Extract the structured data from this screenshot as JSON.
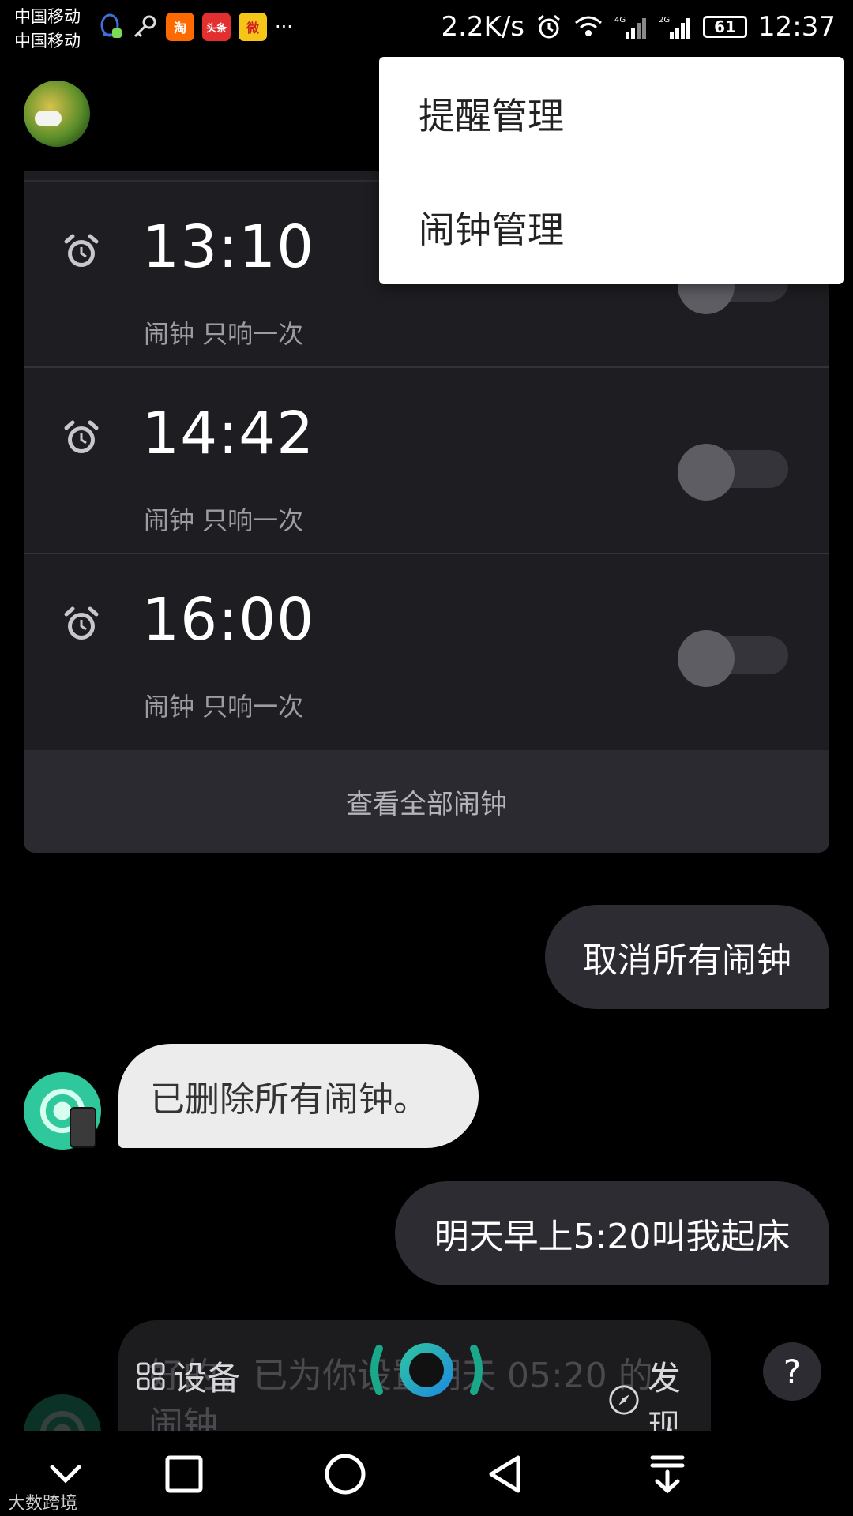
{
  "status_bar": {
    "carrier_1": "中国移动",
    "carrier_2": "中国移动",
    "apps": [
      "淘",
      "头条",
      "微"
    ],
    "more": "···",
    "net_speed": "2.2K/s",
    "net_4g": "4G",
    "net_2g": "2G",
    "battery": "61",
    "time": "12:37"
  },
  "menu": {
    "items": [
      {
        "label": "提醒管理"
      },
      {
        "label": "闹钟管理"
      }
    ]
  },
  "alarms": {
    "items": [
      {
        "time": "13:10",
        "desc": "闹钟 只响一次",
        "enabled": false
      },
      {
        "time": "14:42",
        "desc": "闹钟 只响一次",
        "enabled": false
      },
      {
        "time": "16:00",
        "desc": "闹钟 只响一次",
        "enabled": false
      }
    ],
    "view_all": "查看全部闹钟"
  },
  "chat": {
    "user_1": "取消所有闹钟",
    "bot_1": "已删除所有闹钟。",
    "user_2": "明天早上5:20叫我起床",
    "bot_2_partial_1": "好的，已为你设置明天 05:20 的",
    "bot_2_partial_2": "闹钟"
  },
  "dock": {
    "devices_label": "设备",
    "discover_label": "发现",
    "help_label": "?"
  },
  "watermark": "大数跨境",
  "colors": {
    "background": "#000000",
    "card": "#1e1e22",
    "accent_teal": "#2fc79c",
    "accent_blue": "#1e88e5"
  }
}
